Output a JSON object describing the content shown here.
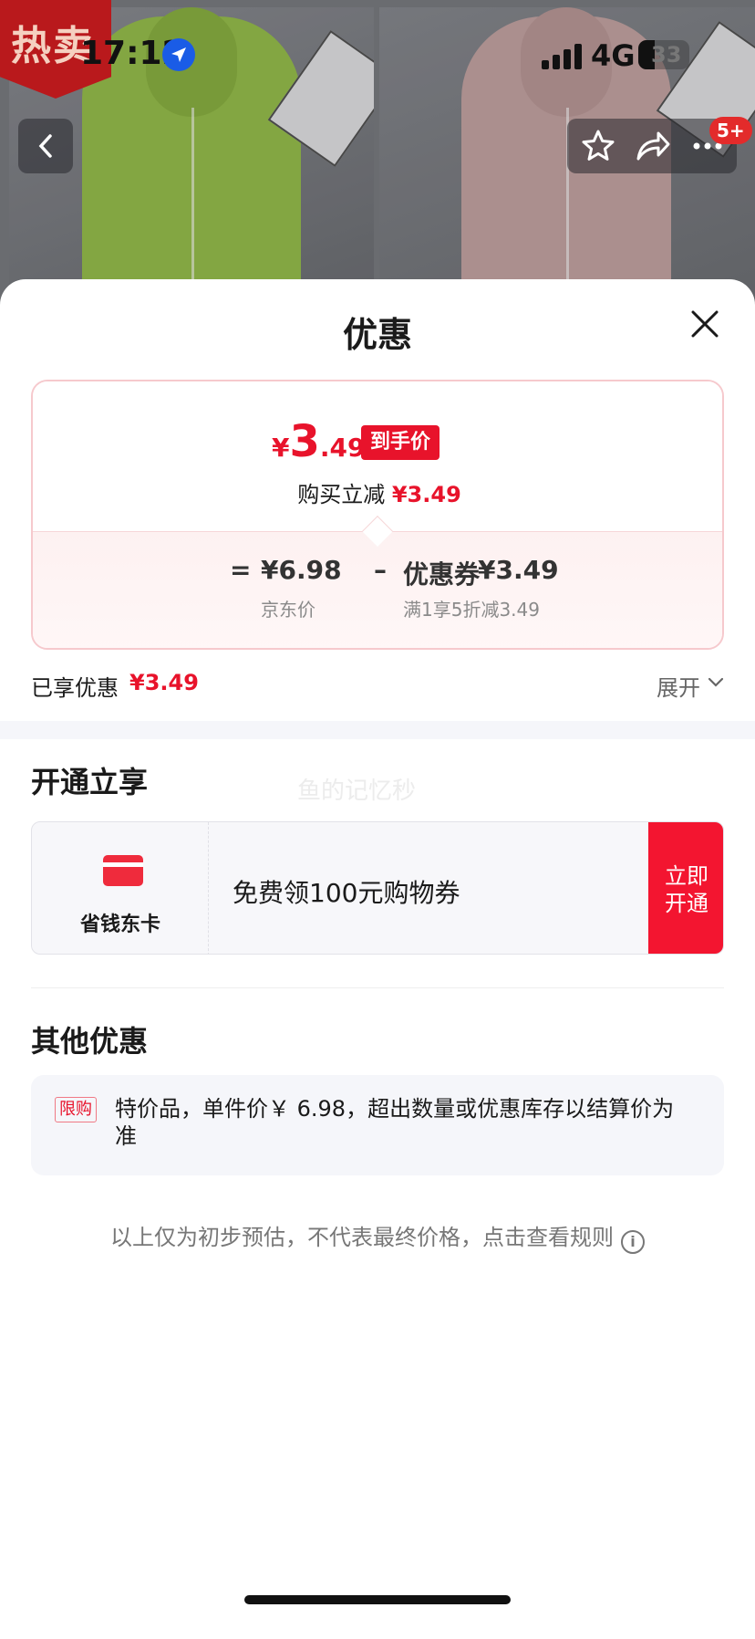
{
  "status_bar": {
    "time": "17:12",
    "network": "4G",
    "battery": "33"
  },
  "background": {
    "hot_badge": "热卖",
    "cart_count": "5+"
  },
  "sheet": {
    "title": "优惠",
    "price_card": {
      "final_price_symbol": "¥",
      "final_price_int": "3",
      "final_price_dec": ".49",
      "final_tag": "到手价",
      "instant_cut_label": "购买立减",
      "instant_cut_value": "¥3.49",
      "formula": {
        "equals": "=",
        "jd_price": "¥6.98",
        "minus": "–",
        "coupon_label": "优惠券",
        "coupon_value": "¥3.49",
        "jd_price_label": "京东价",
        "coupon_rule": "满1享5折减3.49"
      }
    },
    "enjoyed": {
      "label": "已享优惠",
      "value": "¥3.49",
      "expand_label": "展开"
    },
    "member_section": {
      "title": "开通立享",
      "watermark": "鱼的记忆秒",
      "card_name": "省钱东卡",
      "description": "免费领100元购物券",
      "open_button_line1": "立即",
      "open_button_line2": "开通"
    },
    "other_section": {
      "title": "其他优惠",
      "limit_tag": "限购",
      "text": "特价品，单件价￥ 6.98，超出数量或优惠库存以结算价为准"
    },
    "rules_text": "以上仅为初步预估，不代表最终价格，点击查看规则",
    "info_icon": "i"
  },
  "colors": {
    "accent_red": "#e8132b",
    "open_button": "#f31530",
    "card_border": "#f6c9cd"
  },
  "icons": [
    "location-arrow-icon",
    "signal-icon",
    "battery-icon",
    "back-chevron-icon",
    "star-icon",
    "share-icon",
    "more-icon",
    "close-icon",
    "card-icon",
    "chevron-down-icon",
    "info-icon"
  ]
}
